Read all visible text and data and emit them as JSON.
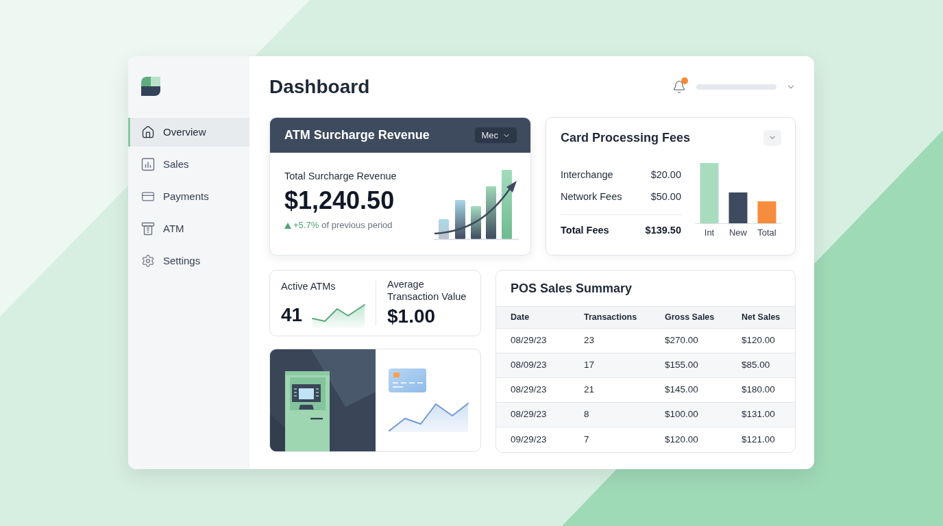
{
  "sidebar": {
    "items": [
      {
        "label": "Overview",
        "selected": true
      },
      {
        "label": "Sales",
        "selected": false
      },
      {
        "label": "Payments",
        "selected": false
      },
      {
        "label": "ATM",
        "selected": false
      },
      {
        "label": "Settings",
        "selected": false
      }
    ]
  },
  "header": {
    "title": "Dashboard",
    "has_unread": true
  },
  "atm_card": {
    "title": "ATM Surcharge Revenue",
    "period": "Mec",
    "metric_label": "Total Surcharge Revenue",
    "metric_value": "$1,240.50",
    "trend": {
      "rising": true,
      "change": "+5.7%",
      "text": "of previous period"
    }
  },
  "fees_card": {
    "title": "Card Processing Fees",
    "rows": [
      {
        "label": "Interchange",
        "value": "$20.00"
      },
      {
        "label": "Network Fees",
        "value": "$50.00"
      }
    ],
    "total": {
      "label": "Total Fees",
      "value": "$139.50"
    },
    "bars": [
      {
        "label": "Int",
        "color": "#a8dcbf"
      },
      {
        "label": "New",
        "color": "#3e4b5e"
      },
      {
        "label": "Total",
        "color": "#f68c3d"
      }
    ]
  },
  "stats": [
    {
      "kind": "sparkline",
      "label": "Active ATMs",
      "value": "41"
    },
    {
      "kind": "plain",
      "label": "Average Transaction Value",
      "value": "$1.00"
    }
  ],
  "pos_table": {
    "title": "POS Sales Summary",
    "columns": [
      "Date",
      "Transactions",
      "Gross Sales",
      "Net Sales"
    ],
    "rows": [
      [
        "08/29/23",
        "23",
        "$270.00",
        "$120.00"
      ],
      [
        "08/09/23",
        "17",
        "$155.00",
        "$85.00"
      ],
      [
        "08/29/23",
        "21",
        "$145.00",
        "$180.00"
      ],
      [
        "08/29/23",
        "8",
        "$100.00",
        "$131.00"
      ],
      [
        "09/29/23",
        "7",
        "$120.00",
        "$121.00"
      ]
    ]
  }
}
